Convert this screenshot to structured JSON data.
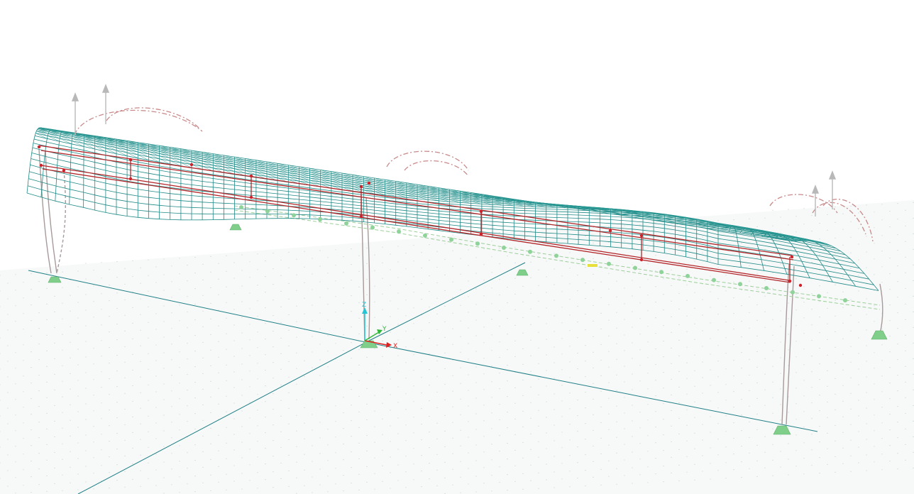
{
  "viewport": {
    "background": "#ffffff",
    "floor_color": "#f7f8f8",
    "grid_line_color": "#1e7f85",
    "mesh_color": "#1f8a86",
    "member_color": "#b3262a",
    "column_color": "#a79a9a",
    "load_arc_color": "#c88a8a",
    "support_color": "#7fcf8a",
    "arrow_color": "#b8b8b8"
  },
  "axes": {
    "x_label": "X",
    "y_label": "Y",
    "z_label": "Z",
    "x_color": "#e02020",
    "y_color": "#2db83a",
    "z_color": "#22c4d6"
  }
}
